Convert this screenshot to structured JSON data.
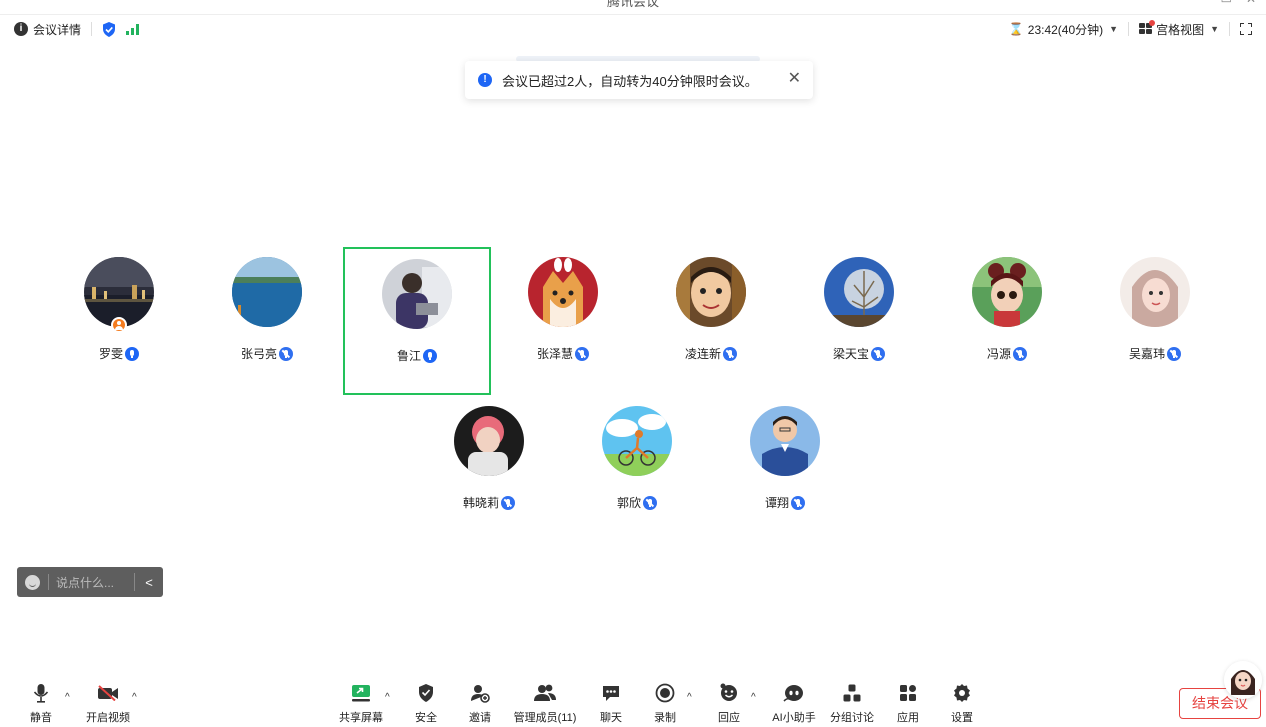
{
  "window": {
    "title": "腾讯会议"
  },
  "topbar": {
    "meeting_details": "会议详情",
    "timer": "23:42(40分钟)",
    "view_mode": "宫格视图"
  },
  "notice": {
    "text": "会议已超过2人，自动转为40分钟限时会议。"
  },
  "participants": [
    {
      "name": "罗雯",
      "host": true
    },
    {
      "name": "张弓亮"
    },
    {
      "name": "鲁江",
      "active": true
    },
    {
      "name": "张泽慧"
    },
    {
      "name": "凌连新"
    },
    {
      "name": "梁天宝"
    },
    {
      "name": "冯源"
    },
    {
      "name": "吴嘉玮"
    },
    {
      "name": "韩晓莉"
    },
    {
      "name": "郭欣"
    },
    {
      "name": "谭翔"
    }
  ],
  "chat": {
    "placeholder": "说点什么..."
  },
  "toolbar": {
    "mute": "静音",
    "video": "开启视频",
    "share": "共享屏幕",
    "security": "安全",
    "invite": "邀请",
    "members": "管理成员(11)",
    "chat": "聊天",
    "record": "录制",
    "react": "回应",
    "ai": "AI小助手",
    "breakout": "分组讨论",
    "apps": "应用",
    "settings": "设置",
    "end": "结束会议"
  },
  "colors": {
    "accent": "#1e66f5",
    "active_border": "#22c15a",
    "danger": "#e64340",
    "host": "#f47c20"
  }
}
